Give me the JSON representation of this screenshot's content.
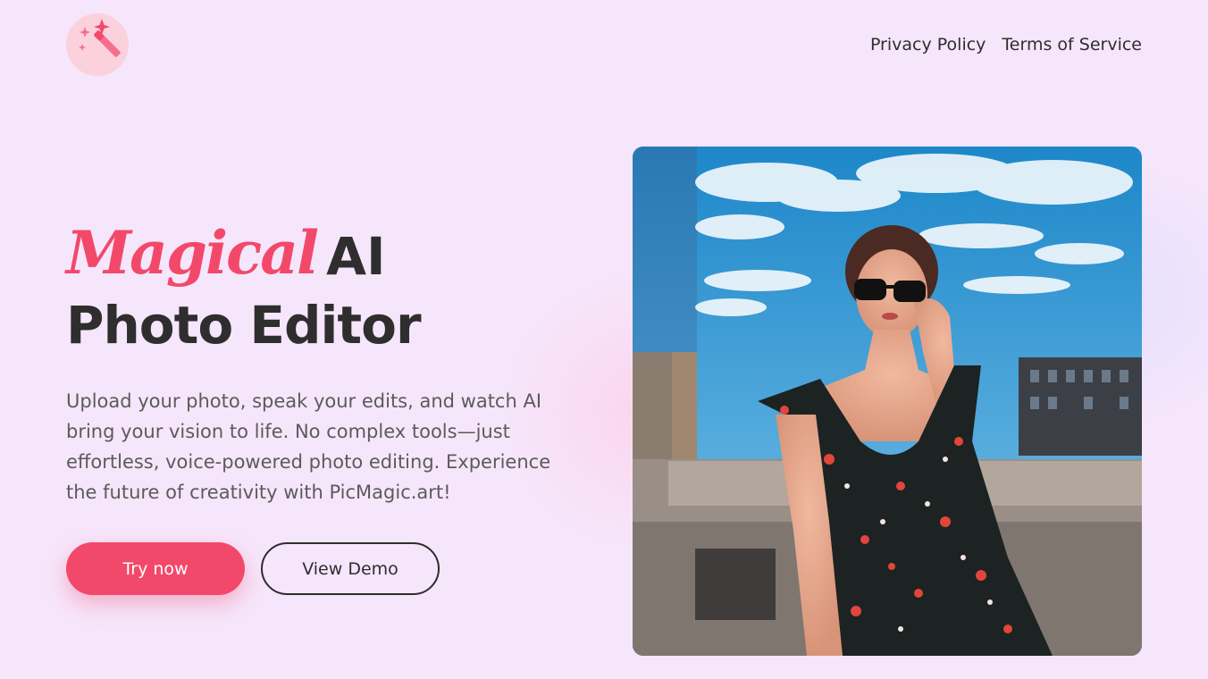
{
  "header": {
    "logo_icon": "magic-wand-icon",
    "nav": [
      {
        "label": "Privacy Policy"
      },
      {
        "label": "Terms of Service"
      }
    ]
  },
  "hero": {
    "title_highlight": "Magical",
    "title_rest": "AI",
    "title_line2": "Photo Editor",
    "description": "Upload your photo, speak your edits, and watch AI bring your vision to life. No complex tools—just effortless, voice-powered photo editing. Experience the future of creativity with PicMagic.art!",
    "primary_button": "Try now",
    "secondary_button": "View Demo"
  },
  "colors": {
    "background": "#f6e6fb",
    "accent": "#f2496a",
    "text": "#2e2e2e"
  }
}
